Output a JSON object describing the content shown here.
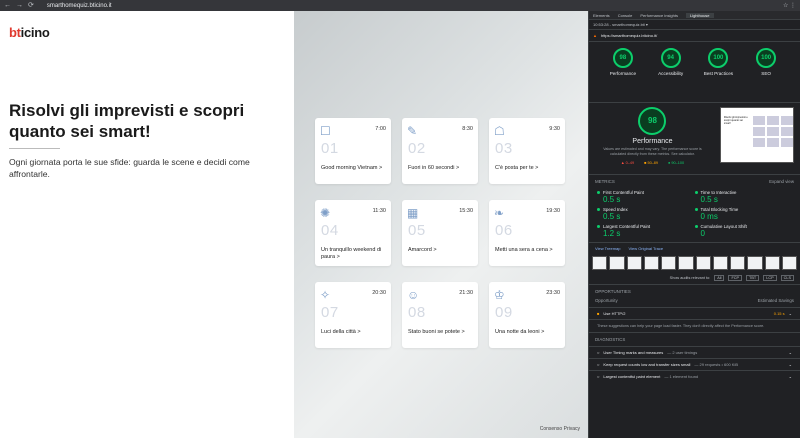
{
  "browser": {
    "url": "smarthomequiz.bticino.it",
    "back": "←",
    "forward": "→",
    "reload": "⟳",
    "ext_icons": "☆ ⋮"
  },
  "site": {
    "logo_b": "bt",
    "logo_rest": "icino",
    "title": "Risolvi gli imprevisti e scopri quanto sei smart!",
    "subtitle": "Ogni giornata porta le sue sfide: guarda le scene e decidi come affrontarle.",
    "consent": "Consenso Privacy",
    "cards": [
      {
        "time": "7:00",
        "num": "01",
        "label": "Good morning Vietnam >",
        "icon": "☐"
      },
      {
        "time": "8:30",
        "num": "02",
        "label": "Fuori in 60 secondi >",
        "icon": "✎"
      },
      {
        "time": "9:30",
        "num": "03",
        "label": "C'è posta per te >",
        "icon": "☖"
      },
      {
        "time": "11:30",
        "num": "04",
        "label": "Un tranquillo weekend di paura >",
        "icon": "✺"
      },
      {
        "time": "15:30",
        "num": "05",
        "label": "Amarcord >",
        "icon": "▦"
      },
      {
        "time": "19:30",
        "num": "06",
        "label": "Metti una sera a cena >",
        "icon": "❧"
      },
      {
        "time": "20:30",
        "num": "07",
        "label": "Luci della città >",
        "icon": "✧"
      },
      {
        "time": "21:30",
        "num": "08",
        "label": "Stato buoni se potete >",
        "icon": "☺"
      },
      {
        "time": "23:30",
        "num": "09",
        "label": "Una notte da leoni >",
        "icon": "♔"
      }
    ]
  },
  "devtools": {
    "tabs": [
      "Elements",
      "Console",
      "Performance insights",
      "Lighthouse"
    ],
    "subbar": "10:53:28 - smarthomequiz.bti ▾",
    "report_url": "https://smarthomequiz.bticino.it/",
    "scores": [
      {
        "value": "98",
        "label": "Performance"
      },
      {
        "value": "94",
        "label": "Accessibility"
      },
      {
        "value": "100",
        "label": "Best Practices"
      },
      {
        "value": "100",
        "label": "SEO"
      }
    ],
    "perf_score": "98",
    "perf_title": "Performance",
    "perf_desc": "Values are estimated and may vary. The performance score is calculated directly from these metrics. See calculator.",
    "legend": {
      "red": "▲ 0–49",
      "orange": "■ 50–89",
      "green": "● 90–100"
    },
    "metrics_title": "METRICS",
    "expand_view": "Expand view",
    "metrics": [
      {
        "name": "First Contentful Paint",
        "value": "0.5 s"
      },
      {
        "name": "Time to Interactive",
        "value": "0.5 s"
      },
      {
        "name": "Speed Index",
        "value": "0.5 s"
      },
      {
        "name": "Total Blocking Time",
        "value": "0 ms"
      },
      {
        "name": "Largest Contentful Paint",
        "value": "1.2 s"
      },
      {
        "name": "Cumulative Layout Shift",
        "value": "0"
      }
    ],
    "view_treemap": "View Treemap",
    "view_trace": "View Original Trace",
    "show_audits": "Show audits relevant to:",
    "audit_chips": [
      "All",
      "FCP",
      "TBT",
      "LCP",
      "CLS"
    ],
    "opportunities_title": "OPPORTUNITIES",
    "opp_col1": "Opportunity",
    "opp_col2": "Estimated Savings",
    "opportunity": {
      "name": "Use HTTP/2",
      "saving": "0.15 s"
    },
    "opp_note": "These suggestions can help your page load faster. They don't directly affect the Performance score.",
    "diagnostics_title": "DIAGNOSTICS",
    "diagnostics": [
      {
        "name": "User Timing marks and measures",
        "sub": "— 2 user timings"
      },
      {
        "name": "Keep request counts low and transfer sizes small",
        "sub": "— 29 requests • 600 KiB"
      },
      {
        "name": "Largest contentful paint element",
        "sub": "— 1 element found"
      }
    ]
  }
}
